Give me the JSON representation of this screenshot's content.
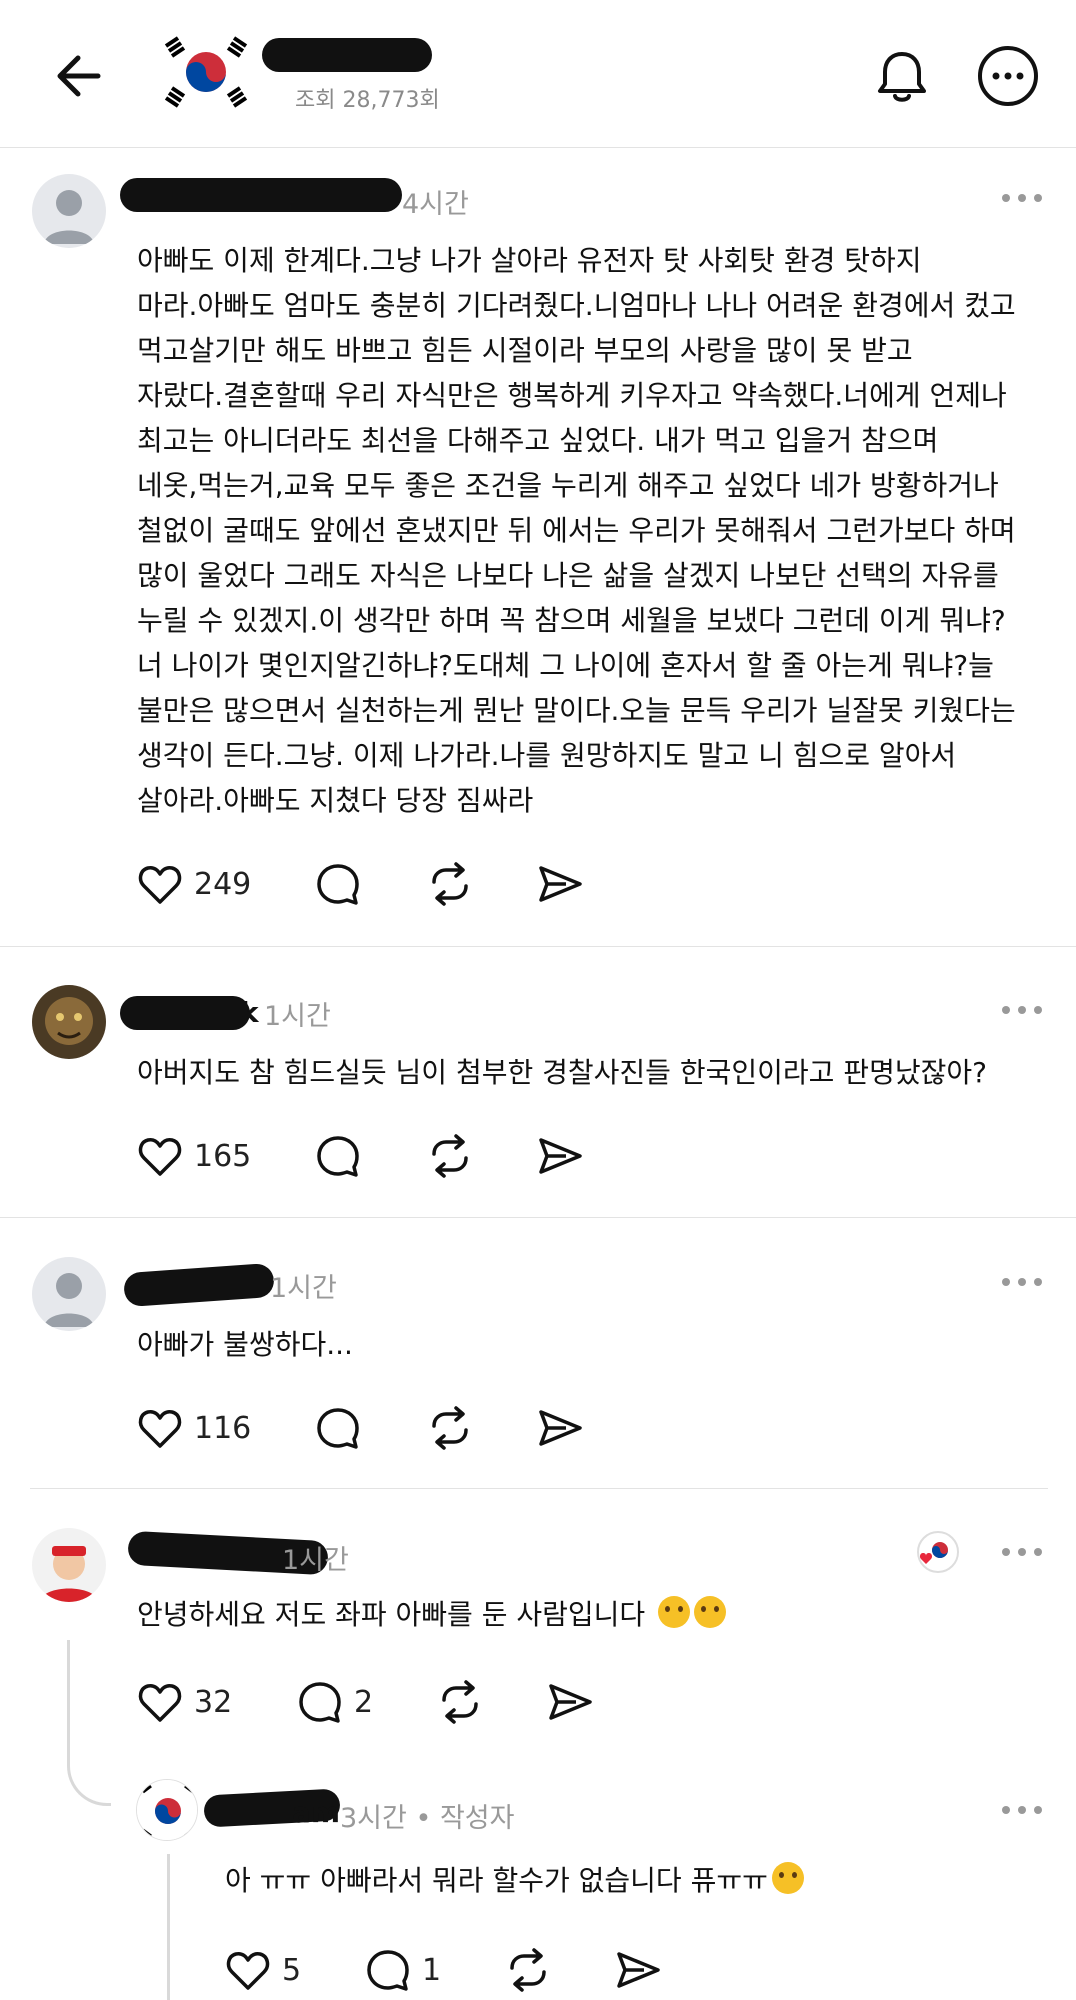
{
  "header": {
    "views": "조회 28,773회"
  },
  "posts": [
    {
      "time": "4시간",
      "text": "아빠도 이제 한계다.그냥 나가 살아라 유전자 탓 사회탓 환경 탓하지\n마라.아빠도 엄마도 충분히 기다려줬다.니엄마나 나나 어려운 환경에서 컸고\n먹고살기만 해도 바쁘고 힘든 시절이라 부모의 사랑을 많이 못 받고\n자랐다.결혼할때 우리 자식만은 행복하게 키우자고 약속했다.너에게 언제나\n최고는 아니더라도 최선을 다해주고 싶었다. 내가 먹고 입을거 참으며\n네옷,먹는거,교육 모두 좋은 조건을 누리게 해주고 싶었다 네가 방황하거나\n철없이 굴때도 앞에선 혼냈지만 뒤 에서는 우리가 못해줘서 그런가보다 하며\n많이 울었다 그래도 자식은 나보다 나은 삶을 살겠지 나보단 선택의 자유를\n누릴 수 있겠지.이 생각만 하며 꼭 참으며 세월을 보냈다 그런데 이게 뭐냐?\n너 나이가 몇인지알긴하냐?도대체 그 나이에 혼자서 할 줄 아는게 뭐냐?늘\n불만은 많으면서 실천하는게 뭔난 말이다.오늘 문득 우리가 닐잘못 키웠다는\n생각이 든다.그냥. 이제 나가라.나를 원망하지도 말고 니 힘으로 알아서\n살아라.아빠도 지쳤다 당장 짐싸라",
      "likes": "249"
    },
    {
      "author_tail": "k",
      "time": "1시간",
      "text": "아버지도 참 힘드실듯 님이 첨부한 경찰사진들 한국인이라고 판명났잖아?",
      "likes": "165"
    },
    {
      "time": "1시간",
      "text": "아빠가 불쌍하다...",
      "likes": "116"
    },
    {
      "time": "1시간",
      "text": "안녕하세요 저도 좌파 아빠를 둔 사람입니다",
      "likes": "32",
      "replies": "2"
    },
    {
      "author_tail": "am",
      "time": "3시간 • 작성자",
      "text": "아 ㅠㅠ 아빠라서 뭐라 할수가 없습니다 퓨ㅠㅠ",
      "likes": "5",
      "replies": "1"
    }
  ],
  "colors": {
    "text": "#101010",
    "muted": "#999999",
    "divider": "#e3e3e3",
    "like_heart": "#e8283c"
  },
  "icons": [
    "back-arrow-icon",
    "korea-flag-icon",
    "bell-icon",
    "more-icon",
    "heart-icon",
    "comment-icon",
    "repost-icon",
    "share-icon",
    "smile-emoji-icon"
  ]
}
